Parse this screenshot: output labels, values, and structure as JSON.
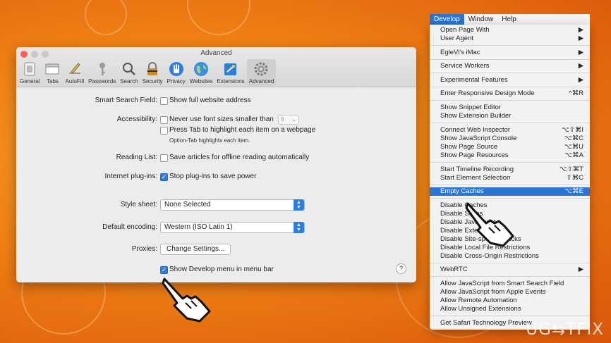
{
  "window": {
    "title": "Advanced"
  },
  "toolbar": [
    {
      "label": "General",
      "icon": "switch-icon"
    },
    {
      "label": "Tabs",
      "icon": "tabs-icon"
    },
    {
      "label": "AutoFill",
      "icon": "pencil-icon"
    },
    {
      "label": "Passwords",
      "icon": "key-icon"
    },
    {
      "label": "Search",
      "icon": "magnifier-icon"
    },
    {
      "label": "Security",
      "icon": "lock-icon"
    },
    {
      "label": "Privacy",
      "icon": "hand-icon"
    },
    {
      "label": "Websites",
      "icon": "globe-icon"
    },
    {
      "label": "Extensions",
      "icon": "puzzle-icon"
    },
    {
      "label": "Advanced",
      "icon": "gear-icon",
      "active": true
    }
  ],
  "settings": {
    "smart_search": {
      "label": "Smart Search Field:",
      "option": "Show full website address",
      "checked": false
    },
    "accessibility": {
      "label": "Accessibility:",
      "font_option": "Never use font sizes smaller than",
      "font_size": "9",
      "tab_option": "Press Tab to highlight each item on a webpage",
      "tab_note": "Option-Tab highlights each item."
    },
    "reading_list": {
      "label": "Reading List:",
      "option": "Save articles for offline reading automatically"
    },
    "plugins": {
      "label": "Internet plug-ins:",
      "option": "Stop plug-ins to save power",
      "checked": true
    },
    "style_sheet": {
      "label": "Style sheet:",
      "value": "None Selected"
    },
    "encoding": {
      "label": "Default encoding:",
      "value": "Western (ISO Latin 1)"
    },
    "proxies": {
      "label": "Proxies:",
      "button": "Change Settings..."
    },
    "develop": {
      "option": "Show Develop menu in menu bar",
      "checked": true
    },
    "help": "?"
  },
  "menubar": [
    "Develop",
    "Window",
    "Help"
  ],
  "menu": {
    "items": [
      {
        "label": "Open Page With",
        "shortcut": "▶"
      },
      {
        "label": "User Agent",
        "shortcut": "▶"
      },
      {
        "label": "EgleVi's iMac",
        "shortcut": "▶"
      },
      {
        "label": "Service Workers",
        "shortcut": "▶"
      },
      {
        "label": "Experimental Features",
        "shortcut": "▶"
      },
      {
        "label": "Enter Responsive Design Mode",
        "shortcut": "^⌘R"
      },
      {
        "label": "Show Snippet Editor",
        "shortcut": ""
      },
      {
        "label": "Show Extension Builder",
        "shortcut": ""
      },
      {
        "label": "Connect Web Inspector",
        "shortcut": "⌥⇧⌘I"
      },
      {
        "label": "Show JavaScript Console",
        "shortcut": "⌥⌘C"
      },
      {
        "label": "Show Page Source",
        "shortcut": "⌥⌘U"
      },
      {
        "label": "Show Page Resources",
        "shortcut": "⌥⌘A"
      },
      {
        "label": "Start Timeline Recording",
        "shortcut": "⌥⇧⌘T"
      },
      {
        "label": "Start Element Selection",
        "shortcut": "⇧⌘C"
      },
      {
        "label": "Empty Caches",
        "shortcut": "⌥⌘E",
        "highlighted": true
      },
      {
        "label": "Disable Caches",
        "shortcut": ""
      },
      {
        "label": "Disable Styles",
        "shortcut": ""
      },
      {
        "label": "Disable JavaScript",
        "shortcut": ""
      },
      {
        "label": "Disable Extensions",
        "shortcut": ""
      },
      {
        "label": "Disable Site-specific Hacks",
        "shortcut": ""
      },
      {
        "label": "Disable Local File Restrictions",
        "shortcut": ""
      },
      {
        "label": "Disable Cross-Origin Restrictions",
        "shortcut": ""
      },
      {
        "label": "WebRTC",
        "shortcut": "▶"
      },
      {
        "label": "Allow JavaScript from Smart Search Field",
        "shortcut": ""
      },
      {
        "label": "Allow JavaScript from Apple Events",
        "shortcut": ""
      },
      {
        "label": "Allow Remote Automation",
        "shortcut": ""
      },
      {
        "label": "Allow Unsigned Extensions",
        "shortcut": ""
      },
      {
        "label": "Get Safari Technology Preview",
        "shortcut": ""
      }
    ]
  },
  "watermark": "UG⇆TFIX",
  "colors": {
    "accent": "#2a75d6",
    "background": "#ef7f14"
  }
}
